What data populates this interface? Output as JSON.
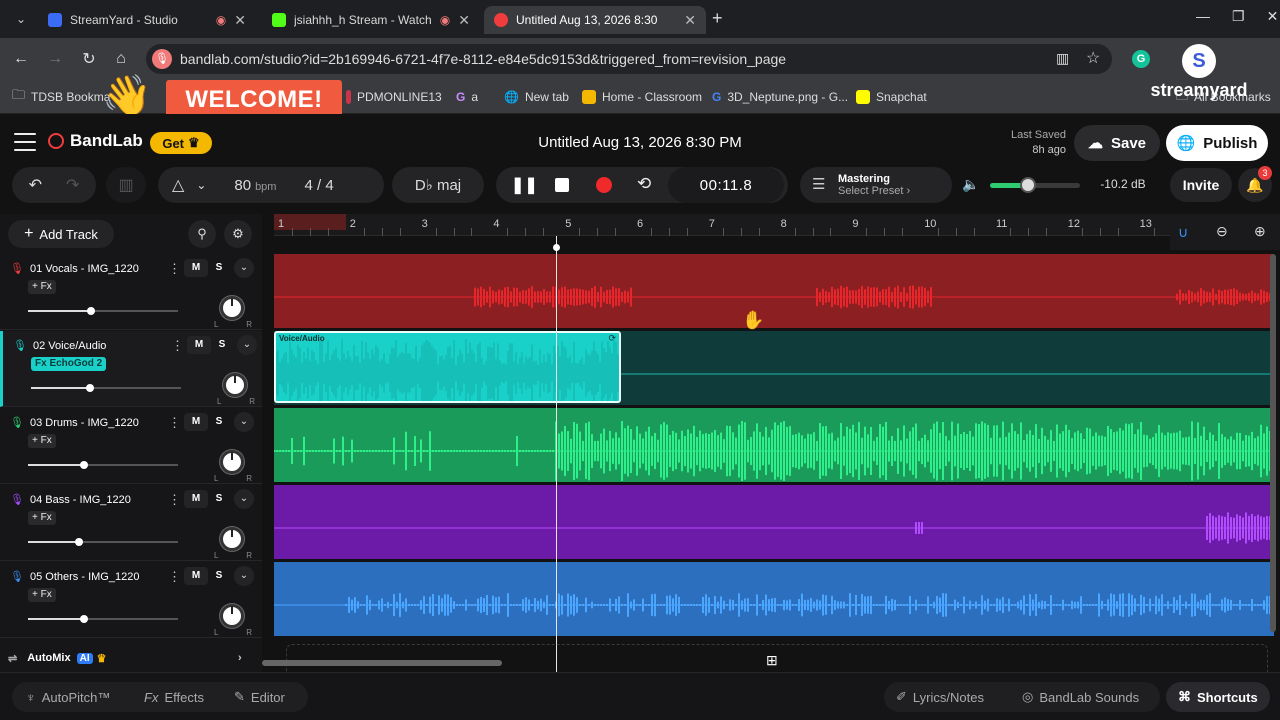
{
  "browser": {
    "tabs": [
      {
        "title": "StreamYard - Studio",
        "favicon_color": "#3b6cf6",
        "active": false
      },
      {
        "title": "jsiahhh_h Stream - Watch Live",
        "favicon_color": "#53fc18",
        "active": false
      },
      {
        "title": "Untitled Aug 13, 2026 8:30",
        "favicon_color": "#f03c3c",
        "active": true
      }
    ],
    "new_tab": "+",
    "url": "bandlab.com/studio?id=2b169946-6721-4f7e-8112-e84e5dc9153d&triggered_from=revision_page",
    "bookmarks": [
      {
        "label": "TDSB Bookma",
        "icon": "folder-icon"
      },
      {
        "label": "PDMONLINE13",
        "icon": "bookmark-icon"
      },
      {
        "label": "a",
        "icon": "g-icon"
      },
      {
        "label": "New tab",
        "icon": "globe-icon"
      },
      {
        "label": "Home - Classroom",
        "icon": "classroom-icon"
      },
      {
        "label": "3D_Neptune.png - G...",
        "icon": "google-icon"
      },
      {
        "label": "Snapchat",
        "icon": "snapchat-icon"
      }
    ],
    "all_bookmarks": "All Bookmarks"
  },
  "overlay": {
    "welcome": "WELCOME!",
    "streamyard_logo": "streamyard",
    "streamyard_initial": "S"
  },
  "header": {
    "brand": "BandLab",
    "get_label": "Get",
    "project_title": "Untitled Aug 13, 2026 8:30 PM",
    "last_saved_label": "Last Saved",
    "last_saved_value": "8h ago",
    "save_label": "Save",
    "publish_label": "Publish"
  },
  "transport": {
    "bpm_value": "80",
    "bpm_unit": "bpm",
    "time_signature": "4 / 4",
    "key": "D♭ maj",
    "timecode": "00:11.8",
    "mastering_title": "Mastering",
    "mastering_preset": "Select Preset ›",
    "volume_db": "-10.2 dB",
    "volume_level": 0.42,
    "invite_label": "Invite",
    "notifications": "3"
  },
  "tracklist": {
    "add_track_label": "Add Track",
    "tracks": [
      {
        "name": "01  Vocals - IMG_1220",
        "fx": "+ Fx",
        "fx_active": false,
        "icon_color": "#f03c3c",
        "volume": 0.42
      },
      {
        "name": "02  Voice/Audio",
        "fx": "Fx  EchoGod 2",
        "fx_active": true,
        "icon_color": "#19d1c9",
        "volume": 0.39
      },
      {
        "name": "03  Drums - IMG_1220",
        "fx": "+ Fx",
        "fx_active": false,
        "icon_color": "#2ecc71",
        "volume": 0.37
      },
      {
        "name": "04  Bass - IMG_1220",
        "fx": "+ Fx",
        "fx_active": false,
        "icon_color": "#a64dff",
        "volume": 0.34
      },
      {
        "name": "05  Others - IMG_1220",
        "fx": "+ Fx",
        "fx_active": false,
        "icon_color": "#3b8ff0",
        "volume": 0.37
      }
    ],
    "mute_label": "M",
    "solo_label": "S",
    "pan_left": "L",
    "pan_right": "R",
    "automix_label": "AutoMix",
    "automix_ai": "AI"
  },
  "timeline": {
    "bars": [
      "1",
      "2",
      "3",
      "4",
      "5",
      "6",
      "7",
      "8",
      "9",
      "10",
      "11",
      "12",
      "13"
    ],
    "clip_label": "Voice/Audio",
    "lane_colors": [
      "#8c1f22",
      "#0f3b3a",
      "#1a9b5a",
      "#6c1aa8",
      "#2d6fbf"
    ],
    "wave_colors": [
      "#e6262b",
      "#1bb9b2",
      "#2ef08a",
      "#b24cff",
      "#4aa6ff"
    ]
  },
  "footer": {
    "autopitch": "AutoPitch™",
    "effects": "Effects",
    "effects_prefix": "Fx",
    "editor": "Editor",
    "lyrics": "Lyrics/Notes",
    "sounds": "BandLab Sounds",
    "shortcuts": "Shortcuts"
  }
}
